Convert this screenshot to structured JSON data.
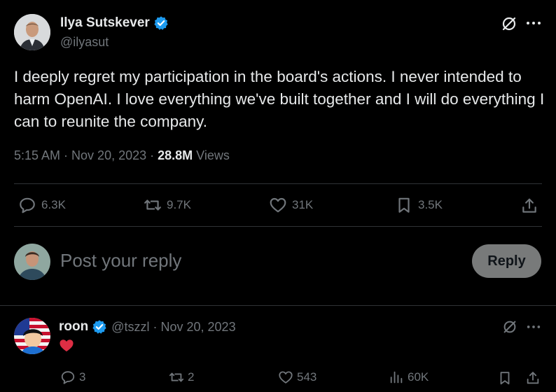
{
  "tweet": {
    "author_name": "Ilya Sutskever",
    "author_handle": "@ilyasut",
    "text": "I deeply regret my participation in the board's actions. I never intended to harm OpenAI. I love everything we've built together and I will do everything I can to reunite the company.",
    "time": "5:15 AM",
    "date": "Nov 20, 2023",
    "separator": "·",
    "views_count": "28.8M",
    "views_label": "Views",
    "stats": {
      "replies": "6.3K",
      "retweets": "9.7K",
      "likes": "31K",
      "bookmarks": "3.5K"
    }
  },
  "composer": {
    "placeholder": "Post your reply",
    "button_label": "Reply"
  },
  "reply": {
    "author_name": "roon",
    "author_handle": "@tszzl",
    "separator": "·",
    "date": "Nov 20, 2023",
    "text": "❤️",
    "stats": {
      "replies": "3",
      "retweets": "2",
      "likes": "543",
      "views": "60K"
    }
  },
  "colors": {
    "background": "#000000",
    "text": "#e7e9ea",
    "muted": "#71767b",
    "verified": "#1d9bf0",
    "divider": "#2f3336",
    "reply_button": "#787a7a"
  },
  "icons": [
    "verified-badge-icon",
    "grok-icon",
    "more-icon",
    "reply-icon",
    "retweet-icon",
    "like-icon",
    "bookmark-icon",
    "share-icon",
    "views-icon",
    "heart-emoji"
  ]
}
